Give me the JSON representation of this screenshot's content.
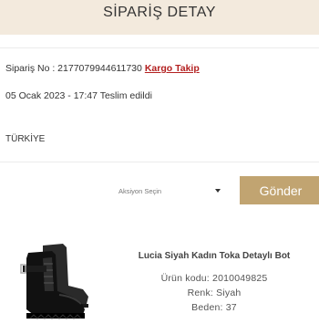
{
  "header": {
    "title": "SİPARİŞ DETAY"
  },
  "order": {
    "number_text": "Sipariş No : 2177079944611730",
    "tracking_label": "Kargo Takip",
    "delivered_text": "05 Ocak 2023 - 17:47 Teslim edildi",
    "country": "TÜRKİYE"
  },
  "actions": {
    "select_placeholder": "Aksiyon Seçin",
    "send_label": "Gönder"
  },
  "product": {
    "name": "Lucia Siyah Kadın Toka Detaylı Bot",
    "code": "Ürün kodu: 2010049825",
    "color": "Renk: Siyah",
    "size": "Beden: 37"
  },
  "colors": {
    "header_bg": "#f3eadd",
    "link": "#b32020",
    "button": "#c1a471"
  }
}
